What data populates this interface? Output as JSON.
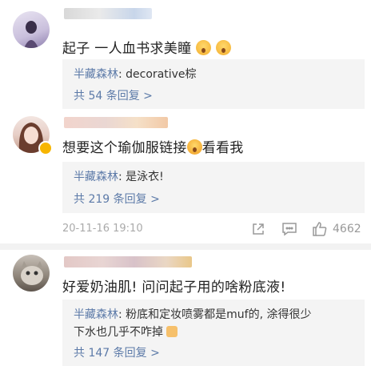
{
  "comments": [
    {
      "text": "起子 一人血书求美瞳",
      "reply": {
        "author": "半藏森林",
        "sep": ": ",
        "text": "decorative棕"
      },
      "reply_count": "共 54 条回复 >"
    },
    {
      "text_before": "想要这个瑜伽服链接",
      "text_after": "看看我",
      "reply": {
        "author": "半藏森林",
        "sep": ": ",
        "text": "是泳衣!"
      },
      "reply_count": "共 219 条回复 >",
      "timestamp": "20-11-16 19:10",
      "like_count": "4662"
    },
    {
      "text": "好爱奶油肌! 问问起子用的啥粉底液!",
      "reply": {
        "author": "半藏森林",
        "sep": ": ",
        "text": "粉底和定妆喷雾都是muf的, 涂得很少",
        "text2": "下水也几乎不咋掉"
      },
      "reply_count": "共 147 条回复 >"
    }
  ],
  "colors": {
    "link": "#5c7aa8",
    "reply_bg": "#f4f4f4",
    "meta": "#aaaaaa"
  },
  "icons": [
    "share-icon",
    "comment-icon",
    "like-icon",
    "crying-emoji",
    "shocked-emoji",
    "thumbs-up-emoji"
  ]
}
